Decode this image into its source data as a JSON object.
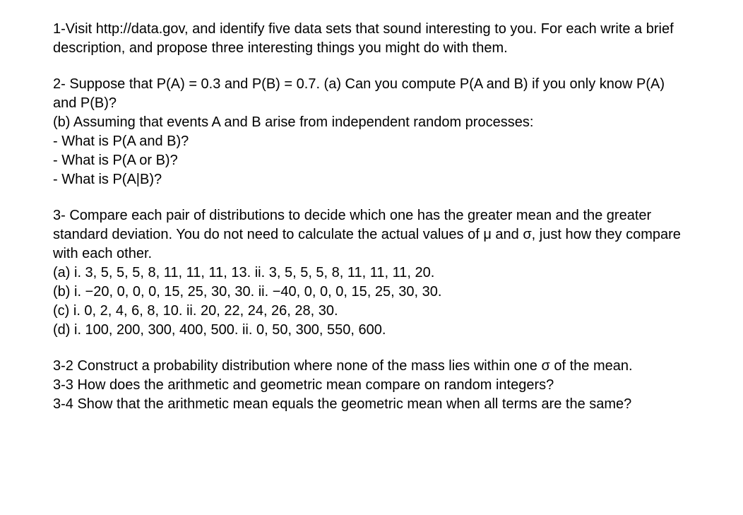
{
  "q1": {
    "text": "1-Visit http://data.gov, and identify five data sets that sound interesting to you. For each write a brief description, and propose three interesting things you might do with them."
  },
  "q2": {
    "intro": "2- Suppose that P(A) = 0.3 and P(B) = 0.7. (a) Can you compute P(A and B) if you only know P(A) and P(B)?",
    "b_intro": "(b) Assuming that events A and B arise from independent random processes:",
    "b1": "- What is P(A and B)?",
    "b2": "- What is P(A or B)?",
    "b3": "-  What is P(A|B)?"
  },
  "q3": {
    "intro": "3- Compare each pair of distributions to decide which one has the greater mean and the greater standard deviation. You do not need to calculate the actual values of μ and σ, just how they compare with each other.",
    "a": "(a) i. 3, 5, 5, 5, 8, 11, 11, 11, 13. ii. 3, 5, 5, 5, 8, 11, 11, 11, 20.",
    "b": "(b) i. −20, 0, 0, 0, 15, 25, 30, 30. ii. −40, 0, 0, 0, 15, 25, 30, 30.",
    "c": "(c) i. 0, 2, 4, 6, 8, 10. ii. 20, 22, 24, 26, 28, 30.",
    "d": "(d) i. 100, 200, 300, 400, 500. ii. 0, 50, 300, 550, 600."
  },
  "q3_2": "3-2 Construct a probability distribution where none of the mass lies within one σ of the mean.",
  "q3_3": "3-3 How does the arithmetic and geometric mean compare on random integers?",
  "q3_4": "3-4 Show that the arithmetic mean equals the geometric mean when all terms are the same?"
}
